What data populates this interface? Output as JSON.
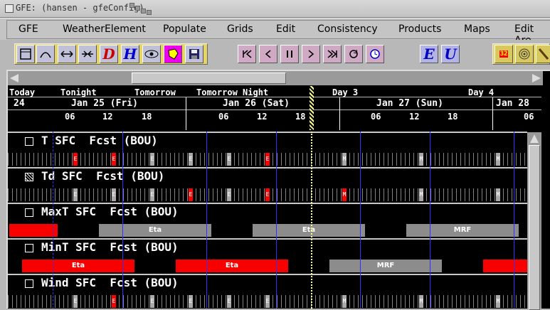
{
  "window": {
    "title": "GFE: (hansen - gfeConfig)"
  },
  "menu": [
    "GFE",
    "WeatherElement",
    "Populate",
    "Grids",
    "Edit",
    "Consistency",
    "Products",
    "Maps",
    "Edit Are"
  ],
  "toolbar": {
    "draw_letter": "D",
    "hist_letter": "H",
    "east_letter": "E",
    "update_letter": "U",
    "count_badge": "32"
  },
  "timescale": {
    "periods": [
      "Today",
      "Tonight",
      "Tomorrow",
      "Tomorrow Night",
      "Day 3",
      "Day 4"
    ],
    "dates": [
      "24",
      "Jan 25 (Fri)",
      "Jan 26 (Sat)",
      "Jan 27 (Sun)",
      "Jan 28"
    ],
    "hours": [
      "06",
      "12",
      "18",
      "06",
      "12",
      "18",
      "06",
      "12",
      "18",
      "06"
    ]
  },
  "rows": [
    {
      "label": "T SFC  Fcst (BOU)",
      "checked": false
    },
    {
      "label": "Td SFC  Fcst (BOU)",
      "checked": true
    },
    {
      "label": "MaxT SFC  Fcst (BOU)",
      "checked": false
    },
    {
      "label": "MinT SFC  Fcst (BOU)",
      "checked": false
    },
    {
      "label": "Wind SFC  Fcst (BOU)",
      "checked": false
    }
  ],
  "grid_letters": {
    "e": "E",
    "m": "M"
  },
  "bar_models": {
    "eta": "Eta",
    "mrf": "MRF"
  },
  "colors": {
    "locked": "#f80000",
    "unlocked": "#8c8c8c",
    "now_line": "#ffff80"
  }
}
